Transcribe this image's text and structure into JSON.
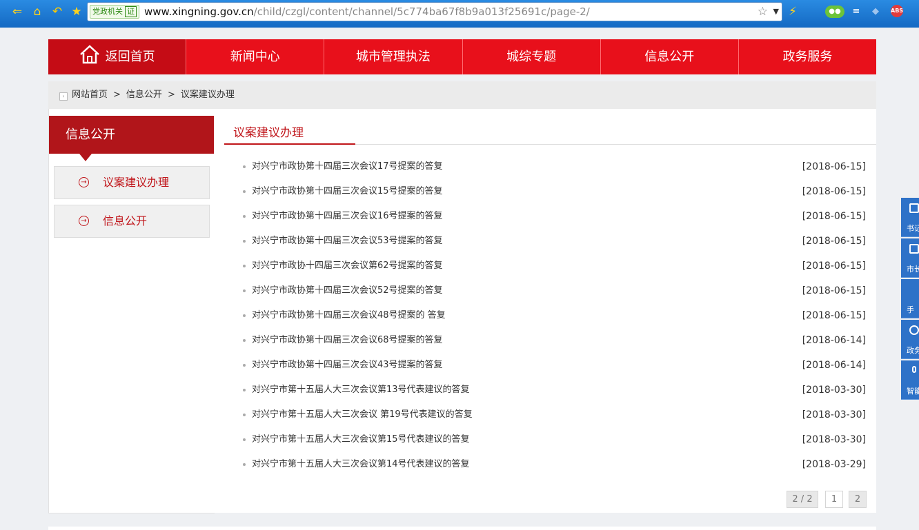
{
  "browser": {
    "gov_badge": "党政机关",
    "cert_badge": "证",
    "url_host": "www.xingning.gov.cn",
    "url_path": "/child/czgl/content/channel/5c774ba67f8b9a013f25691c/page-2/"
  },
  "nav": {
    "home": "返回首页",
    "items": [
      "新闻中心",
      "城市管理执法",
      "城综专题",
      "信息公开",
      "政务服务"
    ]
  },
  "breadcrumb": {
    "home": "网站首页",
    "sep": ">",
    "level1": "信息公开",
    "level2": "议案建议办理"
  },
  "sidebar": {
    "heading": "信息公开",
    "items": [
      "议案建议办理",
      "信息公开"
    ]
  },
  "main": {
    "title": "议案建议办理",
    "items": [
      {
        "title": "对兴宁市政协第十四届三次会议17号提案的答复",
        "date": "[2018-06-15]"
      },
      {
        "title": "对兴宁市政协第十四届三次会议15号提案的答复",
        "date": "[2018-06-15]"
      },
      {
        "title": "对兴宁市政协第十四届三次会议16号提案的答复",
        "date": "[2018-06-15]"
      },
      {
        "title": "对兴宁市政协第十四届三次会议53号提案的答复",
        "date": "[2018-06-15]"
      },
      {
        "title": "对兴宁市政协十四届三次会议第62号提案的答复",
        "date": "[2018-06-15]"
      },
      {
        "title": "对兴宁市政协第十四届三次会议52号提案的答复",
        "date": "[2018-06-15]"
      },
      {
        "title": "对兴宁市政协第十四届三次会议48号提案的 答复",
        "date": "[2018-06-15]"
      },
      {
        "title": "对兴宁市政协第十四届三次会议68号提案的答复",
        "date": "[2018-06-14]"
      },
      {
        "title": "对兴宁市政协第十四届三次会议43号提案的答复",
        "date": "[2018-06-14]"
      },
      {
        "title": "对兴宁市第十五届人大三次会议第13号代表建议的答复",
        "date": "[2018-03-30]"
      },
      {
        "title": "对兴宁市第十五届人大三次会议 第19号代表建议的答复",
        "date": "[2018-03-30]"
      },
      {
        "title": "对兴宁市第十五届人大三次会议第15号代表建议的答复",
        "date": "[2018-03-30]"
      },
      {
        "title": "对兴宁市第十五届人大三次会议第14号代表建议的答复",
        "date": "[2018-03-29]"
      }
    ]
  },
  "pager": {
    "info": "2 / 2",
    "pages": [
      "1",
      "2"
    ],
    "current": "2"
  },
  "float_tabs": [
    "书记",
    "市长",
    "手",
    "政务",
    "智能"
  ],
  "colors": {
    "nav_red": "#e8101b",
    "dark_red": "#b1151a",
    "accent_blue": "#2e72c8"
  }
}
